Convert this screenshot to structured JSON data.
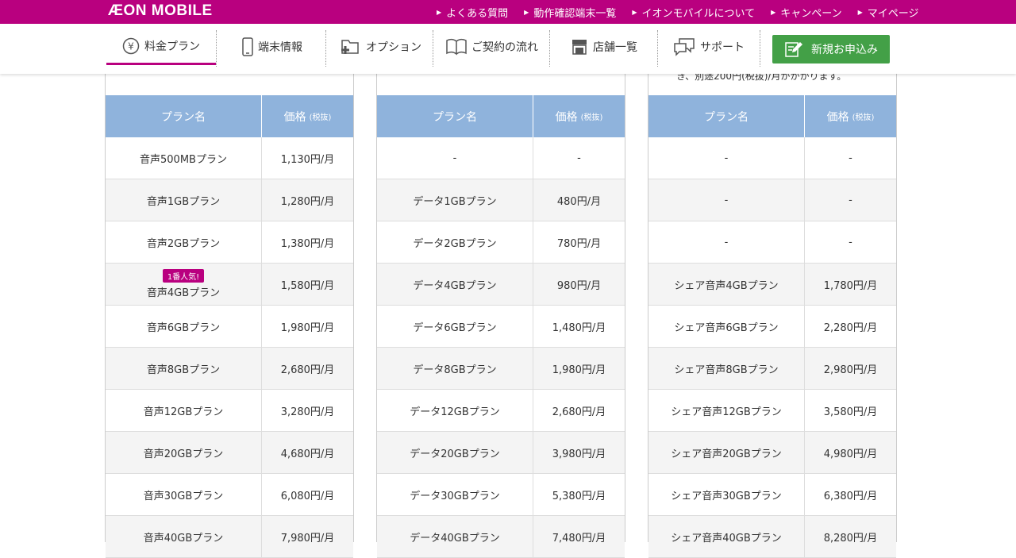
{
  "brand": {
    "logo_text": "ÆON MOBILE"
  },
  "top_links": [
    "よくある質問",
    "動作確認端末一覧",
    "イオンモバイルについて",
    "キャンペーン",
    "マイページ"
  ],
  "nav": {
    "items": [
      "料金プラン",
      "端末情報",
      "オプション",
      "ご契約の流れ",
      "店舗一覧",
      "サポート"
    ],
    "apply_label": "新規お申込み",
    "active": "料金プラン"
  },
  "note_text": "き、別途200円(税抜)/月がかかります。",
  "table_header": {
    "name": "プラン名",
    "price": "価格",
    "tax": "(税抜)"
  },
  "badge_text": "1番人気!",
  "columns": [
    {
      "rows": [
        {
          "name": "音声500MBプラン",
          "price": "1,130円/月"
        },
        {
          "name": "音声1GBプラン",
          "price": "1,280円/月"
        },
        {
          "name": "音声2GBプラン",
          "price": "1,380円/月"
        },
        {
          "name": "音声4GBプラン",
          "price": "1,580円/月",
          "badge": true
        },
        {
          "name": "音声6GBプラン",
          "price": "1,980円/月"
        },
        {
          "name": "音声8GBプラン",
          "price": "2,680円/月"
        },
        {
          "name": "音声12GBプラン",
          "price": "3,280円/月"
        },
        {
          "name": "音声20GBプラン",
          "price": "4,680円/月"
        },
        {
          "name": "音声30GBプラン",
          "price": "6,080円/月"
        },
        {
          "name": "音声40GBプラン",
          "price": "7,980円/月"
        }
      ]
    },
    {
      "rows": [
        {
          "name": "-",
          "price": "-"
        },
        {
          "name": "データ1GBプラン",
          "price": "480円/月"
        },
        {
          "name": "データ2GBプラン",
          "price": "780円/月"
        },
        {
          "name": "データ4GBプラン",
          "price": "980円/月"
        },
        {
          "name": "データ6GBプラン",
          "price": "1,480円/月"
        },
        {
          "name": "データ8GBプラン",
          "price": "1,980円/月"
        },
        {
          "name": "データ12GBプラン",
          "price": "2,680円/月"
        },
        {
          "name": "データ20GBプラン",
          "price": "3,980円/月"
        },
        {
          "name": "データ30GBプラン",
          "price": "5,380円/月"
        },
        {
          "name": "データ40GBプラン",
          "price": "7,480円/月"
        }
      ]
    },
    {
      "rows": [
        {
          "name": "-",
          "price": "-"
        },
        {
          "name": "-",
          "price": "-"
        },
        {
          "name": "-",
          "price": "-"
        },
        {
          "name": "シェア音声4GBプラン",
          "price": "1,780円/月"
        },
        {
          "name": "シェア音声6GBプラン",
          "price": "2,280円/月"
        },
        {
          "name": "シェア音声8GBプラン",
          "price": "2,980円/月"
        },
        {
          "name": "シェア音声12GBプラン",
          "price": "3,580円/月"
        },
        {
          "name": "シェア音声20GBプラン",
          "price": "4,980円/月"
        },
        {
          "name": "シェア音声30GBプラン",
          "price": "6,380円/月"
        },
        {
          "name": "シェア音声40GBプラン",
          "price": "8,280円/月"
        }
      ]
    }
  ]
}
